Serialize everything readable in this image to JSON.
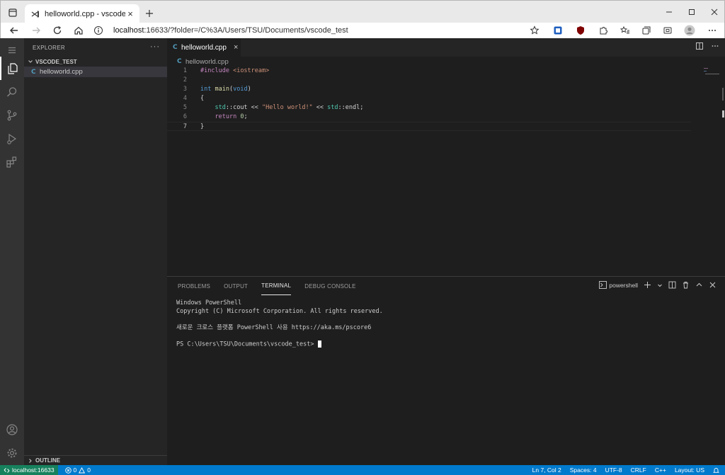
{
  "browser": {
    "tab_title": "helloworld.cpp - vscode_test - co",
    "url_host": "localhost",
    "url_rest": ":16633/?folder=/C%3A/Users/TSU/Documents/vscode_test",
    "new_tab_label": "+",
    "close_tab_label": "×"
  },
  "sidebar": {
    "title": "EXPLORER",
    "more": "···",
    "folder": "VSCODE_TEST",
    "files": [
      {
        "name": "helloworld.cpp"
      }
    ],
    "outline": "OUTLINE"
  },
  "editor": {
    "tab_label": "helloworld.cpp",
    "tab_close": "×",
    "breadcrumb": "helloworld.cpp",
    "lines": [
      {
        "n": "1",
        "text": "#include <iostream>"
      },
      {
        "n": "2",
        "text": ""
      },
      {
        "n": "3",
        "text": "int main(void)"
      },
      {
        "n": "4",
        "text": "{"
      },
      {
        "n": "5",
        "text": "    std::cout << \"Hello world!\" << std::endl;"
      },
      {
        "n": "6",
        "text": "    return 0;"
      },
      {
        "n": "7",
        "text": "}"
      }
    ]
  },
  "panel": {
    "tabs": [
      "PROBLEMS",
      "OUTPUT",
      "TERMINAL",
      "DEBUG CONSOLE"
    ],
    "active_tab": "TERMINAL",
    "shell": "powershell",
    "terminal_lines": [
      "Windows PowerShell",
      "Copyright (C) Microsoft Corporation. All rights reserved.",
      "",
      "새로운 크로스 플랫폼 PowerShell 사용 https://aka.ms/pscore6",
      "",
      "PS C:\\Users\\TSU\\Documents\\vscode_test> "
    ]
  },
  "status": {
    "remote": "localhost:16633",
    "errors": "0",
    "warnings": "0",
    "position": "Ln 7, Col 2",
    "spaces": "Spaces: 4",
    "encoding": "UTF-8",
    "eol": "CRLF",
    "language": "C++",
    "layout": "Layout: US"
  },
  "colors": {
    "accent": "#007acc",
    "remote": "#16825d",
    "cpp_icon": "#519aba"
  }
}
